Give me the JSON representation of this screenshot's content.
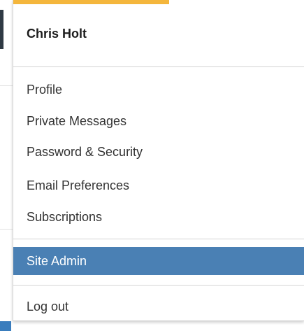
{
  "user": {
    "name": "Chris Holt"
  },
  "menu": {
    "items": [
      {
        "label": "Profile"
      },
      {
        "label": "Private Messages"
      },
      {
        "label": "Password & Security"
      },
      {
        "label": "Email Preferences"
      },
      {
        "label": "Subscriptions"
      }
    ],
    "admin": {
      "label": "Site Admin"
    },
    "logout": {
      "label": "Log out"
    }
  },
  "colors": {
    "accent": "#f4b63c",
    "active_item": "#4a80b4"
  }
}
